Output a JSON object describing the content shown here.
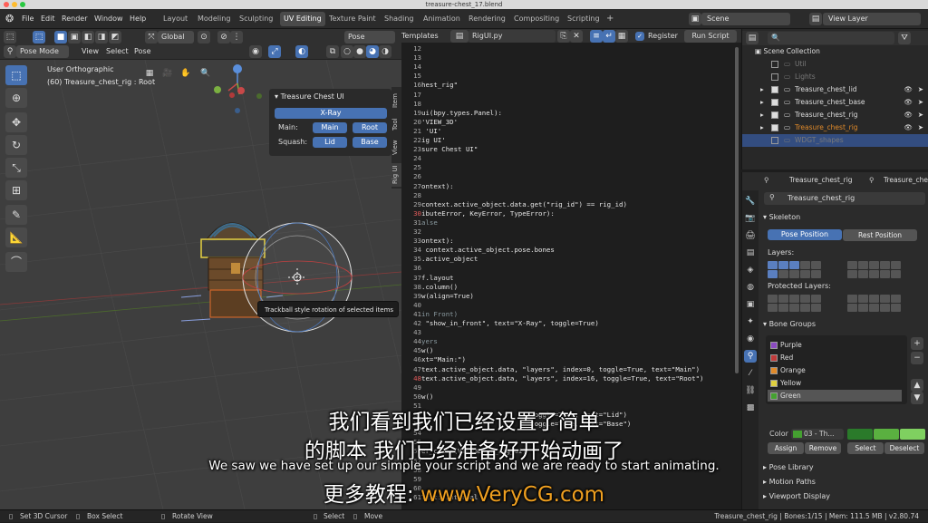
{
  "window": {
    "title": "treasure-chest_17.blend"
  },
  "menu": [
    "File",
    "Edit",
    "Render",
    "Window",
    "Help"
  ],
  "workspaces": [
    "Layout",
    "Modeling",
    "Sculpting",
    "UV Editing",
    "Texture Paint",
    "Shading",
    "Animation",
    "Rendering",
    "Compositing",
    "Scripting"
  ],
  "active_workspace": "UV Editing",
  "scene": "Scene",
  "view_layer": "View Layer",
  "viewport": {
    "mode": "Pose Mode",
    "menus": [
      "View",
      "Select",
      "Pose"
    ],
    "transform": "Global",
    "options": "Pose Options",
    "overlay_line1": "User Orthographic",
    "overlay_line2": "(60) Treasure_chest_rig : Root",
    "tooltip": "Trackball style rotation of selected items",
    "tabs": [
      "Item",
      "Tool",
      "View",
      "Rig UI"
    ]
  },
  "panel": {
    "title": "Treasure Chest UI",
    "xray": "X-Ray",
    "main_label": "Main:",
    "main_btn": "Main",
    "root_btn": "Root",
    "squash_label": "Squash:",
    "lid_btn": "Lid",
    "base_btn": "Base"
  },
  "text_editor": {
    "templates": "Templates",
    "file": "RigUI.py",
    "register": "Register",
    "run": "Run Script",
    "lines": [
      {
        "n": "12",
        "t": ""
      },
      {
        "n": "13",
        "t": ""
      },
      {
        "n": "14",
        "t": ""
      },
      {
        "n": "15",
        "t": ""
      },
      {
        "n": "16",
        "t": "hest_rig\""
      },
      {
        "n": "17",
        "t": ""
      },
      {
        "n": "18",
        "t": ""
      },
      {
        "n": "19",
        "t": "ui(bpy.types.Panel):"
      },
      {
        "n": "20",
        "t": "'VIEW_3D'"
      },
      {
        "n": "21",
        "t": " 'UI'"
      },
      {
        "n": "22",
        "t": "ig UI'"
      },
      {
        "n": "23",
        "t": "sure Chest UI\""
      },
      {
        "n": "24",
        "t": ""
      },
      {
        "n": "25",
        "t": ""
      },
      {
        "n": "26",
        "t": ""
      },
      {
        "n": "27",
        "t": "ontext):"
      },
      {
        "n": "28",
        "t": ""
      },
      {
        "n": "29",
        "t": "context.active_object.data.get(\"rig_id\") == rig_id)"
      },
      {
        "n": "30",
        "t": "ibuteError, KeyError, TypeError):"
      },
      {
        "n": "31",
        "t": "alse"
      },
      {
        "n": "32",
        "t": ""
      },
      {
        "n": "33",
        "t": "ontext):"
      },
      {
        "n": "34",
        "t": " context.active_object.pose.bones"
      },
      {
        "n": "35",
        "t": ".active_object"
      },
      {
        "n": "36",
        "t": ""
      },
      {
        "n": "37",
        "t": "f.layout"
      },
      {
        "n": "38",
        "t": ".column()"
      },
      {
        "n": "39",
        "t": "w(align=True)"
      },
      {
        "n": "40",
        "t": ""
      },
      {
        "n": "41",
        "t": "in Front)"
      },
      {
        "n": "42",
        "t": " \"show_in_front\", text=\"X-Ray\", toggle=True)"
      },
      {
        "n": "43",
        "t": ""
      },
      {
        "n": "44",
        "t": "yers"
      },
      {
        "n": "45",
        "t": "w()"
      },
      {
        "n": "46",
        "t": "xt=\"Main:\")"
      },
      {
        "n": "47",
        "t": "text.active_object.data, \"layers\", index=0, toggle=True, text=\"Main\")"
      },
      {
        "n": "48",
        "t": "text.active_object.data, \"layers\", index=16, toggle=True, text=\"Root\")"
      },
      {
        "n": "49",
        "t": ""
      },
      {
        "n": "50",
        "t": "w()"
      },
      {
        "n": "51",
        "t": ""
      },
      {
        "n": "52",
        "t": "                           toggle=True, text=\"Lid\")"
      },
      {
        "n": "53",
        "t": "                           toggle=True, text=\"Base\")"
      },
      {
        "n": "54",
        "t": ""
      },
      {
        "n": "55",
        "t": ""
      },
      {
        "n": "56",
        "t": "er_class(VIEW3D_PT_rig_ui)"
      },
      {
        "n": "57",
        "t": ""
      },
      {
        "n": "58",
        "t": ""
      },
      {
        "n": "59",
        "t": ""
      },
      {
        "n": "60",
        "t": ""
      },
      {
        "n": "61",
        "t": "Text: Internal"
      }
    ]
  },
  "outliner": {
    "root": "Scene Collection",
    "items": [
      {
        "name": "Util",
        "dim": true
      },
      {
        "name": "Lights",
        "dim": true
      },
      {
        "name": "Treasure_chest_lid"
      },
      {
        "name": "Treasure_chest_base"
      },
      {
        "name": "Treasure_chest_rig"
      },
      {
        "name": "Treasure_chest_rig",
        "orange": true
      },
      {
        "name": "WDGT_shapes",
        "dim": true,
        "selected": true
      }
    ]
  },
  "properties": {
    "tab1": "Treasure_chest_rig",
    "tab2": "Treasure_ches",
    "armature": "Treasure_chest_rig",
    "skeleton": "Skeleton",
    "pose_position": "Pose Position",
    "rest_position": "Rest Position",
    "layers": "Layers:",
    "protected_layers": "Protected Layers:",
    "bone_groups": "Bone Groups",
    "groups": [
      "Purple",
      "Red",
      "Orange",
      "Yellow",
      "Green"
    ],
    "color_label": "Color",
    "color_value": "03 - Th...",
    "assign": "Assign",
    "remove": "Remove",
    "select": "Select",
    "deselect": "Deselect",
    "pose_library": "Pose Library",
    "motion_paths": "Motion Paths",
    "viewport_display": "Viewport Display"
  },
  "status": {
    "set_cursor": "Set 3D Cursor",
    "box_select": "Box Select",
    "rotate": "Rotate View",
    "select": "Select",
    "move": "Move",
    "info": "Treasure_chest_rig | Bones:1/15 | Mem: 111.5 MB | v2.80.74"
  },
  "subtitles": {
    "line1": "我们看到我们已经设置了简单",
    "line2": "的脚本 我们已经准备好开始动画了",
    "line3": "We saw we have set up our simple your script and we are ready to start animating.",
    "line4_prefix": "更多教程:",
    "line4_url": "www.VeryCG.com"
  },
  "colors": {
    "accent": "#4772b3",
    "orange": "#e08a2a",
    "url": "#f0a020"
  }
}
